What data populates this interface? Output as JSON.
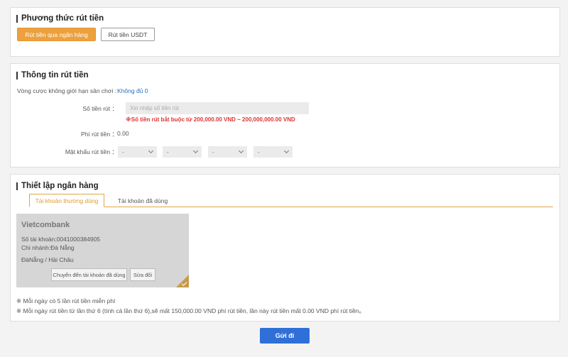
{
  "withdraw_method": {
    "title": "Phương thức rút tiền",
    "buttons": [
      {
        "label": "Rút tiền qua ngân hàng",
        "active": true
      },
      {
        "label": "Rút tiền USDT",
        "active": false
      }
    ]
  },
  "withdraw_info": {
    "title": "Thông tin rút tiền",
    "wager_label": "Vòng cược không giới hạn sân chơi :",
    "wager_value": "Không đủ 0",
    "amount_label": "Số tiền rút ：",
    "amount_placeholder": "Xin nhập số tiền rút",
    "amount_warning": "※Số tiền rút bắt buộc từ 200,000.00 VND ~ 200,000,000.00 VND",
    "fee_label": "Phí rút tiền ：",
    "fee_value": "0.00",
    "password_label": "Mật khẩu rút tiền ：",
    "password_digits": [
      "-",
      "-",
      "-",
      "-"
    ]
  },
  "bank_setup": {
    "title": "Thiết lập ngân hàng",
    "tabs": [
      {
        "label": "Tài khoản thường dùng",
        "active": true
      },
      {
        "label": "Tài khoản đã dùng",
        "active": false
      }
    ],
    "card": {
      "bank_name": "Vietcombank",
      "account": "Số tài khoản:0041000384905",
      "branch": "Chi nhánh:Đà Nẵng",
      "location": "ĐàNẵng / Hải Châu",
      "move_button": "Chuyển đến tài khoản đã dùng",
      "edit_button": "Sửa đổi"
    },
    "notes": [
      "※ Mỗi ngày có 5 lần rút tiền miễn phí",
      "※ Mỗi ngày rút tiền từ lần thứ 6 (tính cả lần thứ 6),sẽ mất 150,000.00 VND phí rút tiền, lần này rút tiền mất 0.00 VND phí rút tiền。"
    ]
  },
  "submit_label": "Gửi đi",
  "colors": {
    "accent_orange": "#eca13d",
    "submit_blue": "#2f6fd8",
    "warning_red": "#d33333",
    "link_blue": "#2a6fb8",
    "card_badge": "#c69b49"
  }
}
